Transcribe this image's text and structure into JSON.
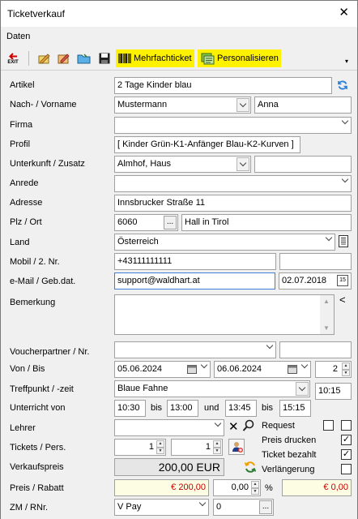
{
  "window": {
    "title": "Ticketverkauf",
    "close": "✕"
  },
  "menu": {
    "daten": "Daten"
  },
  "toolbar": {
    "exit": "EXIT",
    "mehrfach": "Mehrfachticket",
    "personal": "Personalisieren",
    "overflow": "▾"
  },
  "labels": {
    "artikel": "Artikel",
    "name": "Nach- / Vorname",
    "firma": "Firma",
    "profil": "Profil",
    "unterkunft": "Unterkunft / Zusatz",
    "anrede": "Anrede",
    "adresse": "Adresse",
    "plz": "Plz / Ort",
    "land": "Land",
    "mobil": "Mobil / 2. Nr.",
    "email": "e-Mail / Geb.dat.",
    "bemerkung": "Bemerkung",
    "voucher": "Voucherpartner / Nr.",
    "vonbis": "Von / Bis",
    "treffpunkt": "Treffpunkt / -zeit",
    "unterricht": "Unterricht von",
    "bis1": "bis",
    "und": "und",
    "bis2": "bis",
    "lehrer": "Lehrer",
    "tickets": "Tickets / Pers.",
    "verkaufspreis": "Verkaufspreis",
    "preis": "Preis / Rabatt",
    "percent": "%",
    "zm": "ZM / RNr.",
    "request": "Request",
    "preisdrucken": "Preis drucken",
    "bezahlt": "Ticket bezahlt",
    "verlaengerung": "Verlängerung"
  },
  "values": {
    "artikel": "2 Tage Kinder blau",
    "nachname": "Mustermann",
    "vorname": "Anna",
    "firma": "",
    "profil": "[ Kinder Grün-K1-Anfänger Blau-K2-Kurven ]",
    "unterkunft": "Almhof, Haus",
    "zusatz": "",
    "anrede": "",
    "adresse": "Innsbrucker Straße 11",
    "plz": "6060",
    "ort": "Hall in Tirol",
    "land": "Österreich",
    "mobil": "+43111111111",
    "mobil2": "",
    "email": "support@waldhart.at",
    "gebdat": "02.07.2018",
    "voucher": "",
    "vouchernr": "",
    "von": "05.06.2024",
    "bis": "06.06.2024",
    "tage": "2",
    "treffpunkt": "Blaue Fahne",
    "treffzeit": "10:15",
    "u_von1": "10:30",
    "u_bis1": "13:00",
    "u_von2": "13:45",
    "u_bis2": "15:15",
    "lehrer": "",
    "tickets": "1",
    "personen": "1",
    "verkaufspreis": "200,00 EUR",
    "preis": "€ 200,00",
    "rabatt_pct": "0,00",
    "rabatt": "€ 0,00",
    "zm": "V Pay",
    "rnr": "0"
  },
  "checks": {
    "request1": false,
    "request2": false,
    "preisdrucken": true,
    "bezahlt": true,
    "verlaengerung": false
  },
  "glyphs": {
    "ellipsis": "...",
    "plus": "+",
    "x": "✕",
    "collapse": "<",
    "up": "▲",
    "down": "▼",
    "check": "✓",
    "cal": "15"
  },
  "colors": {
    "highlight": "#fff200",
    "focus": "#3c7fd9",
    "price_bg": "#fdfde4",
    "price_red": "#c00000"
  }
}
